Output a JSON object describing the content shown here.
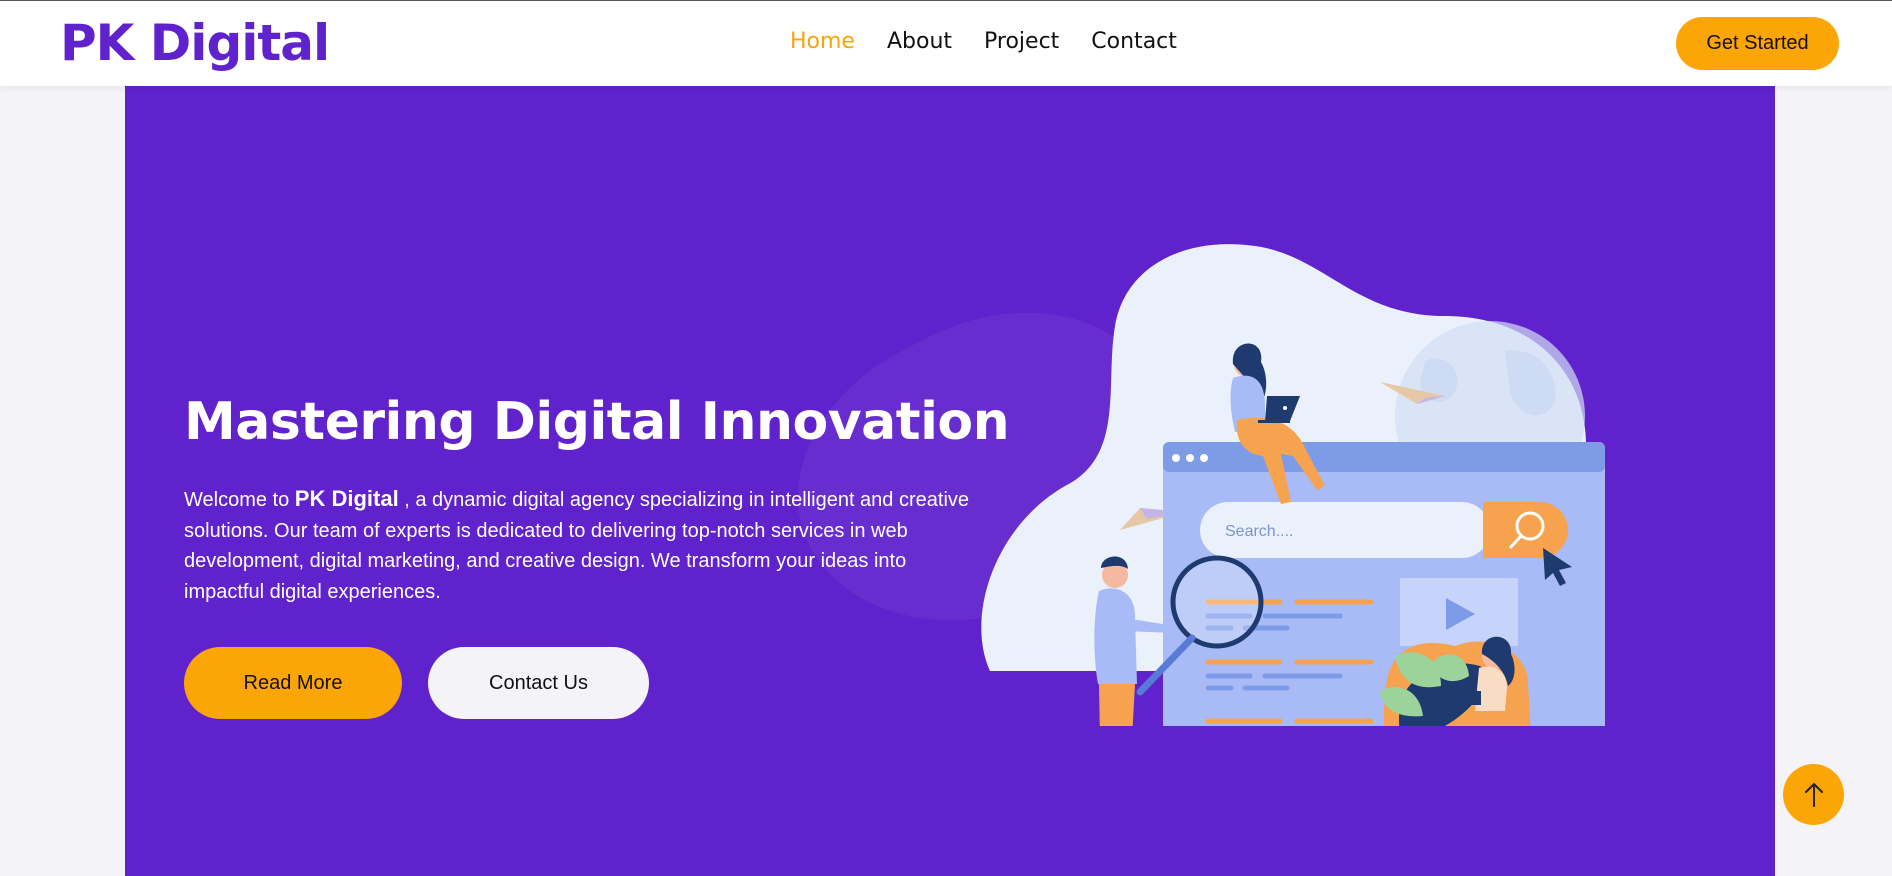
{
  "brand": {
    "logo_text": "PK Digital"
  },
  "nav": {
    "items": [
      "Home",
      "About",
      "Project",
      "Contact"
    ],
    "active": "Home"
  },
  "header": {
    "cta_label": "Get Started"
  },
  "hero": {
    "title": "Mastering Digital Innovation",
    "desc_pre": "Welcome to ",
    "desc_brand": "PK Digital",
    "desc_post": " , a dynamic digital agency specializing in intelligent and creative solutions. Our team of experts is dedicated to delivering top-notch services in web development, digital marketing, and creative design. We transform your ideas into impactful digital experiences.",
    "read_more_label": "Read More",
    "contact_label": "Contact Us",
    "illustration": {
      "search_placeholder": "Search...."
    }
  },
  "scroll_top_icon": "arrow-up-icon",
  "colors": {
    "brand_purple": "#6022cc",
    "accent_orange": "#fba506",
    "active_nav": "#f7a40c",
    "page_bg": "#f4f3f7"
  }
}
